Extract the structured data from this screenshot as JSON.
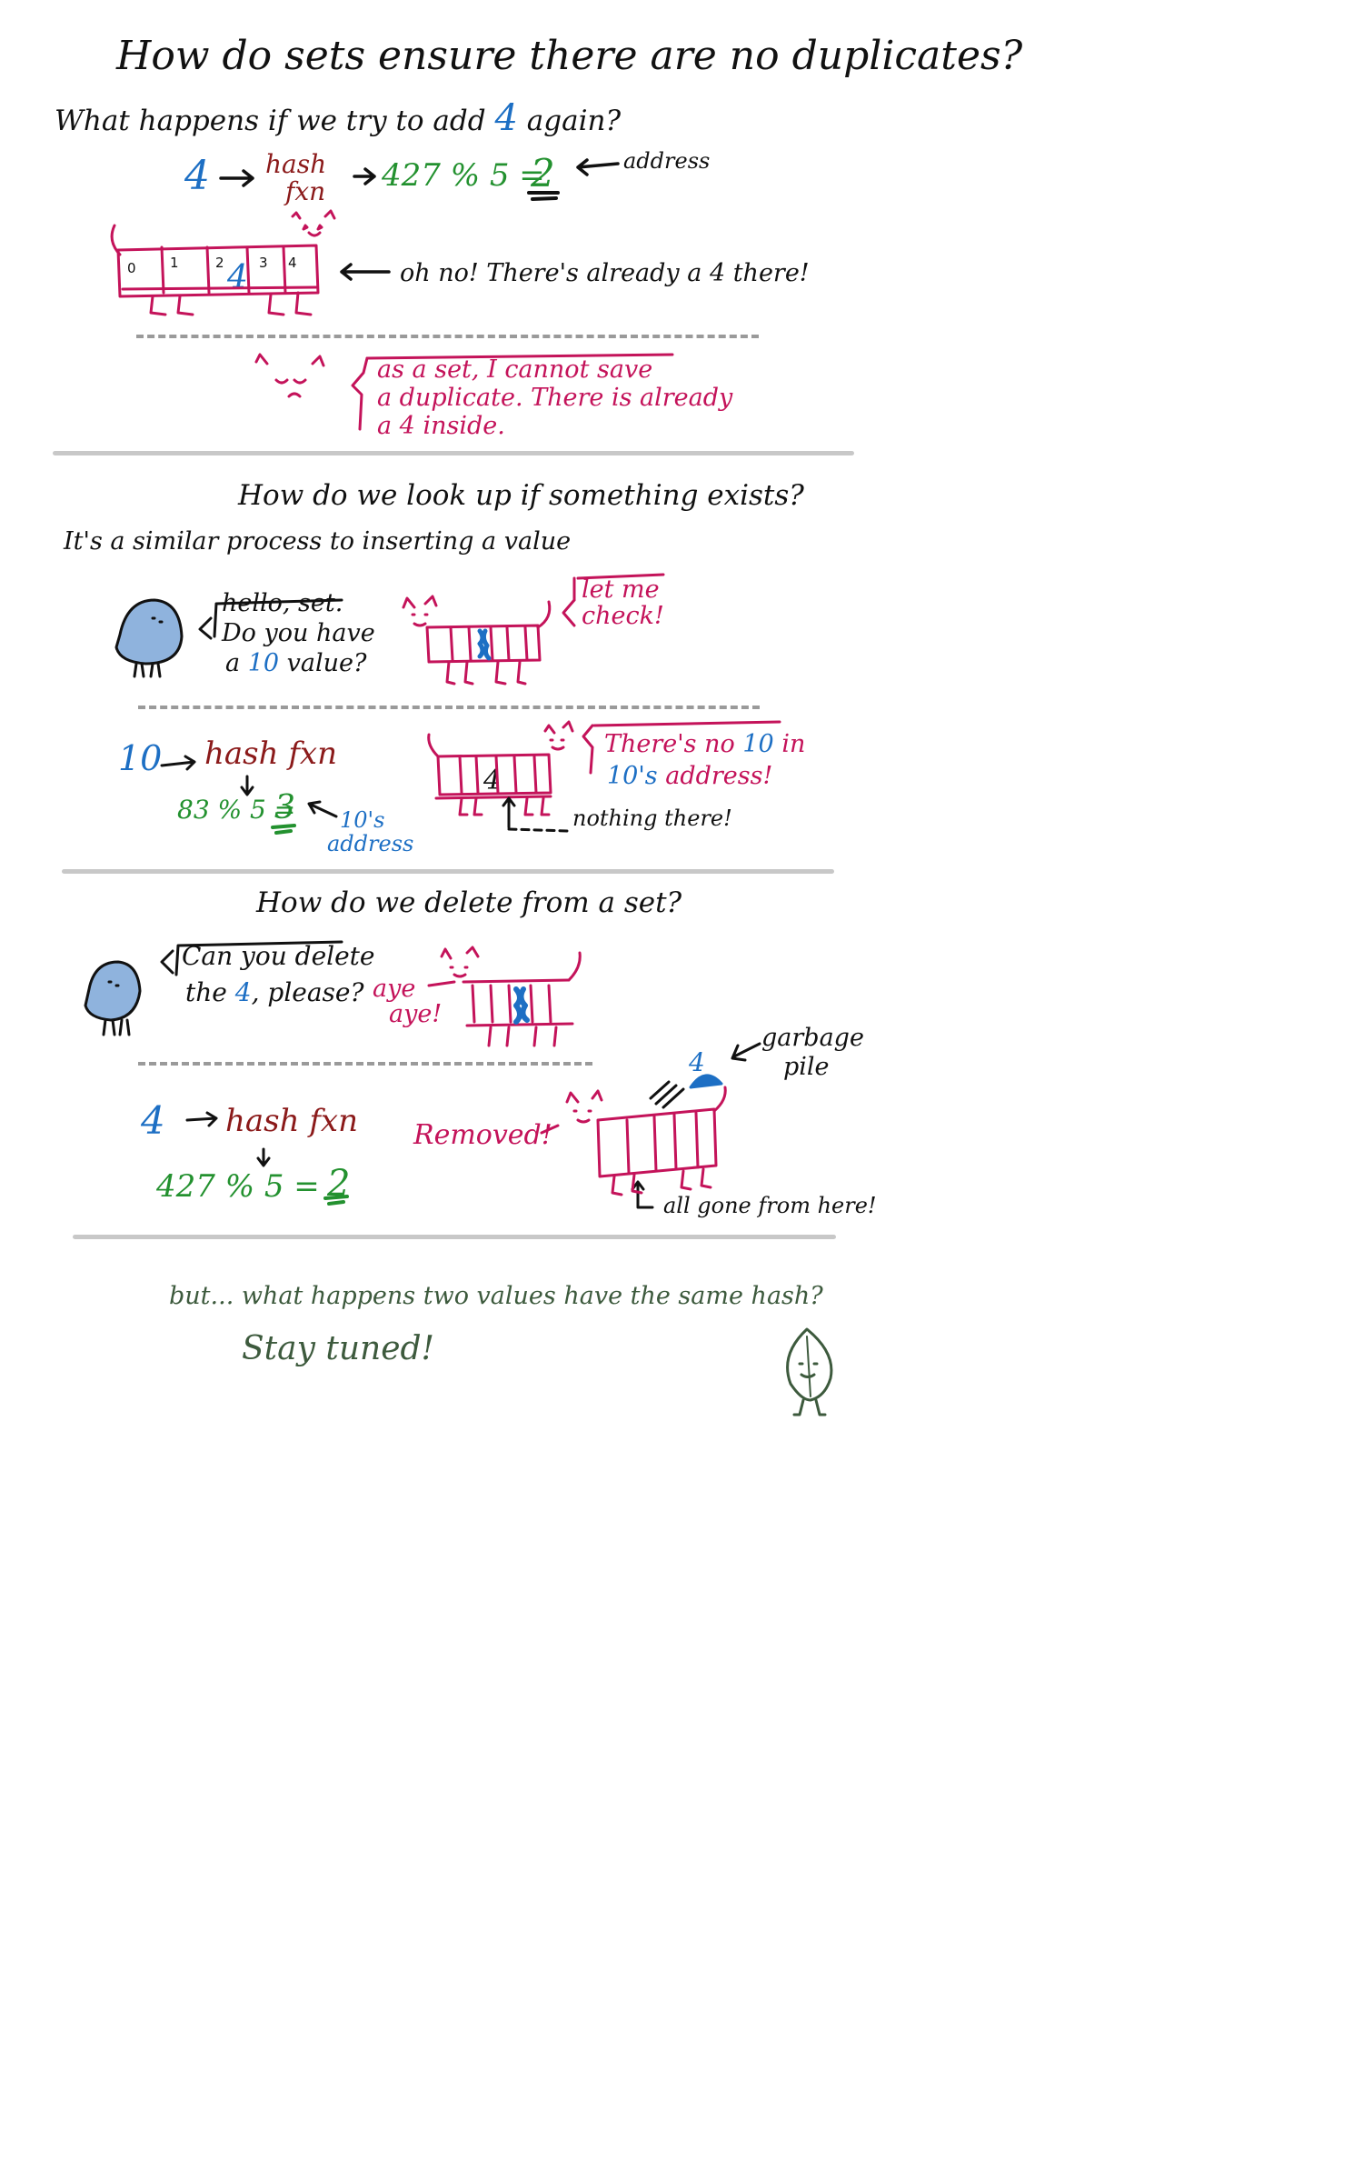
{
  "colors": {
    "black": "#111111",
    "blue": "#1d6fc4",
    "red": "#8b1a1a",
    "green": "#23912f",
    "pink": "#c4135a",
    "gray": "#c8c8c8",
    "bird": "#8fb3dd",
    "leaf": "#3d5a3d"
  },
  "title": "How do sets ensure there are no duplicates?",
  "s1": {
    "question_pre": "What happens if we try to add",
    "question_num": "4",
    "question_post": "again?",
    "value": "4",
    "hash": "hash",
    "fxn": "fxn",
    "calc": "427 % 5 =",
    "result": "2",
    "address_label": "address",
    "indices": [
      "0",
      "1",
      "2",
      "3",
      "4"
    ],
    "stored": "4",
    "oh_no": "oh no! There's already a 4 there!",
    "speech": [
      "as a set, I cannot save",
      "a duplicate. There is already",
      "a 4 inside."
    ]
  },
  "s2": {
    "title": "How do we look up if something exists?",
    "intro": "It's a similar process to inserting a value",
    "bird_line1": "hello, set.",
    "bird_line2": "Do you have",
    "bird_line3_pre": "a",
    "bird_line3_num": "10",
    "bird_line3_post": "value?",
    "cat_speech": [
      "let me",
      "check!"
    ],
    "value": "10",
    "hash_fxn": "hash fxn",
    "calc": "83 % 5 =",
    "result": "3",
    "addr_label": [
      "10's",
      "address"
    ],
    "stored": "4",
    "cat_msg1_pre": "There's no",
    "cat_msg1_num": "10",
    "cat_msg1_post": "in",
    "cat_msg2_num": "10's",
    "cat_msg2_post": "address!",
    "nothing": "nothing there!"
  },
  "s3": {
    "title": "How do we delete from a set?",
    "bird_line1": "Can you delete",
    "bird_line2_pre": "the",
    "bird_line2_num": "4",
    "bird_line2_post": ", please?",
    "aye": [
      "aye",
      "aye!"
    ],
    "value": "4",
    "hash_fxn": "hash fxn",
    "calc": "427 % 5 =",
    "result": "2",
    "removed": "Removed!",
    "garbage_num": "4",
    "garbage": [
      "garbage",
      "pile"
    ],
    "all_gone": "all gone from here!"
  },
  "footer": {
    "question": "but... what happens two values have the same hash?",
    "tuned": "Stay tuned!"
  }
}
